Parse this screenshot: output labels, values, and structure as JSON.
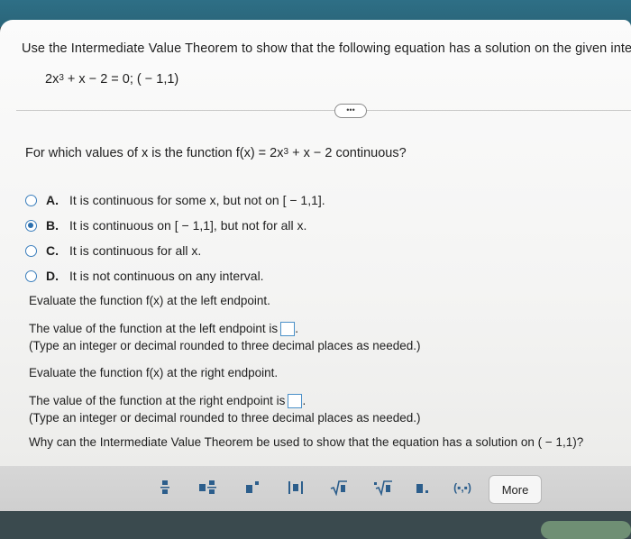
{
  "question": {
    "instruction": "Use the Intermediate Value Theorem to show that the following equation has a solution on the given interval.",
    "equation_prefix": "2x",
    "equation_exp": "3",
    "equation_rest": " + x − 2 = 0; ( − 1,1)"
  },
  "more_indicator": "•••",
  "sub_question": {
    "prefix": "For which values of x is the function f(x) = 2x",
    "exp": "3",
    "suffix": " + x − 2 continuous?"
  },
  "options": [
    {
      "letter": "A.",
      "text": "It is continuous for some x, but not on [ − 1,1].",
      "selected": false
    },
    {
      "letter": "B.",
      "text": "It is continuous on [ − 1,1], but not for all x.",
      "selected": true
    },
    {
      "letter": "C.",
      "text": "It is continuous for all x.",
      "selected": false
    },
    {
      "letter": "D.",
      "text": "It is not continuous on any interval.",
      "selected": false
    }
  ],
  "left_endpoint": {
    "prompt": "Evaluate the function f(x) at the left endpoint.",
    "answer_label": "The value of the function at the left endpoint is",
    "answer_value": "",
    "hint": "(Type an integer or decimal rounded to three decimal places as needed.)"
  },
  "right_endpoint": {
    "prompt": "Evaluate the function f(x) at the right endpoint.",
    "answer_label": "The value of the function at the right endpoint is",
    "answer_value": "",
    "hint": "(Type an integer or decimal rounded to three decimal places as needed.)"
  },
  "final_question": "Why can the Intermediate Value Theorem be used to show that the equation has a solution on ( − 1,1)?",
  "toolbar": {
    "tools": [
      "fraction-icon",
      "mixed-number-icon",
      "exponent-icon",
      "absolute-value-icon",
      "square-root-icon",
      "nth-root-icon",
      "decimal-icon",
      "interval-icon"
    ],
    "interval_label": "(▪,▪)",
    "more_label": "More"
  },
  "colors": {
    "accent": "#2b6fae",
    "top_bar": "#2e6f86",
    "toolbar": "#d4d4d4"
  }
}
